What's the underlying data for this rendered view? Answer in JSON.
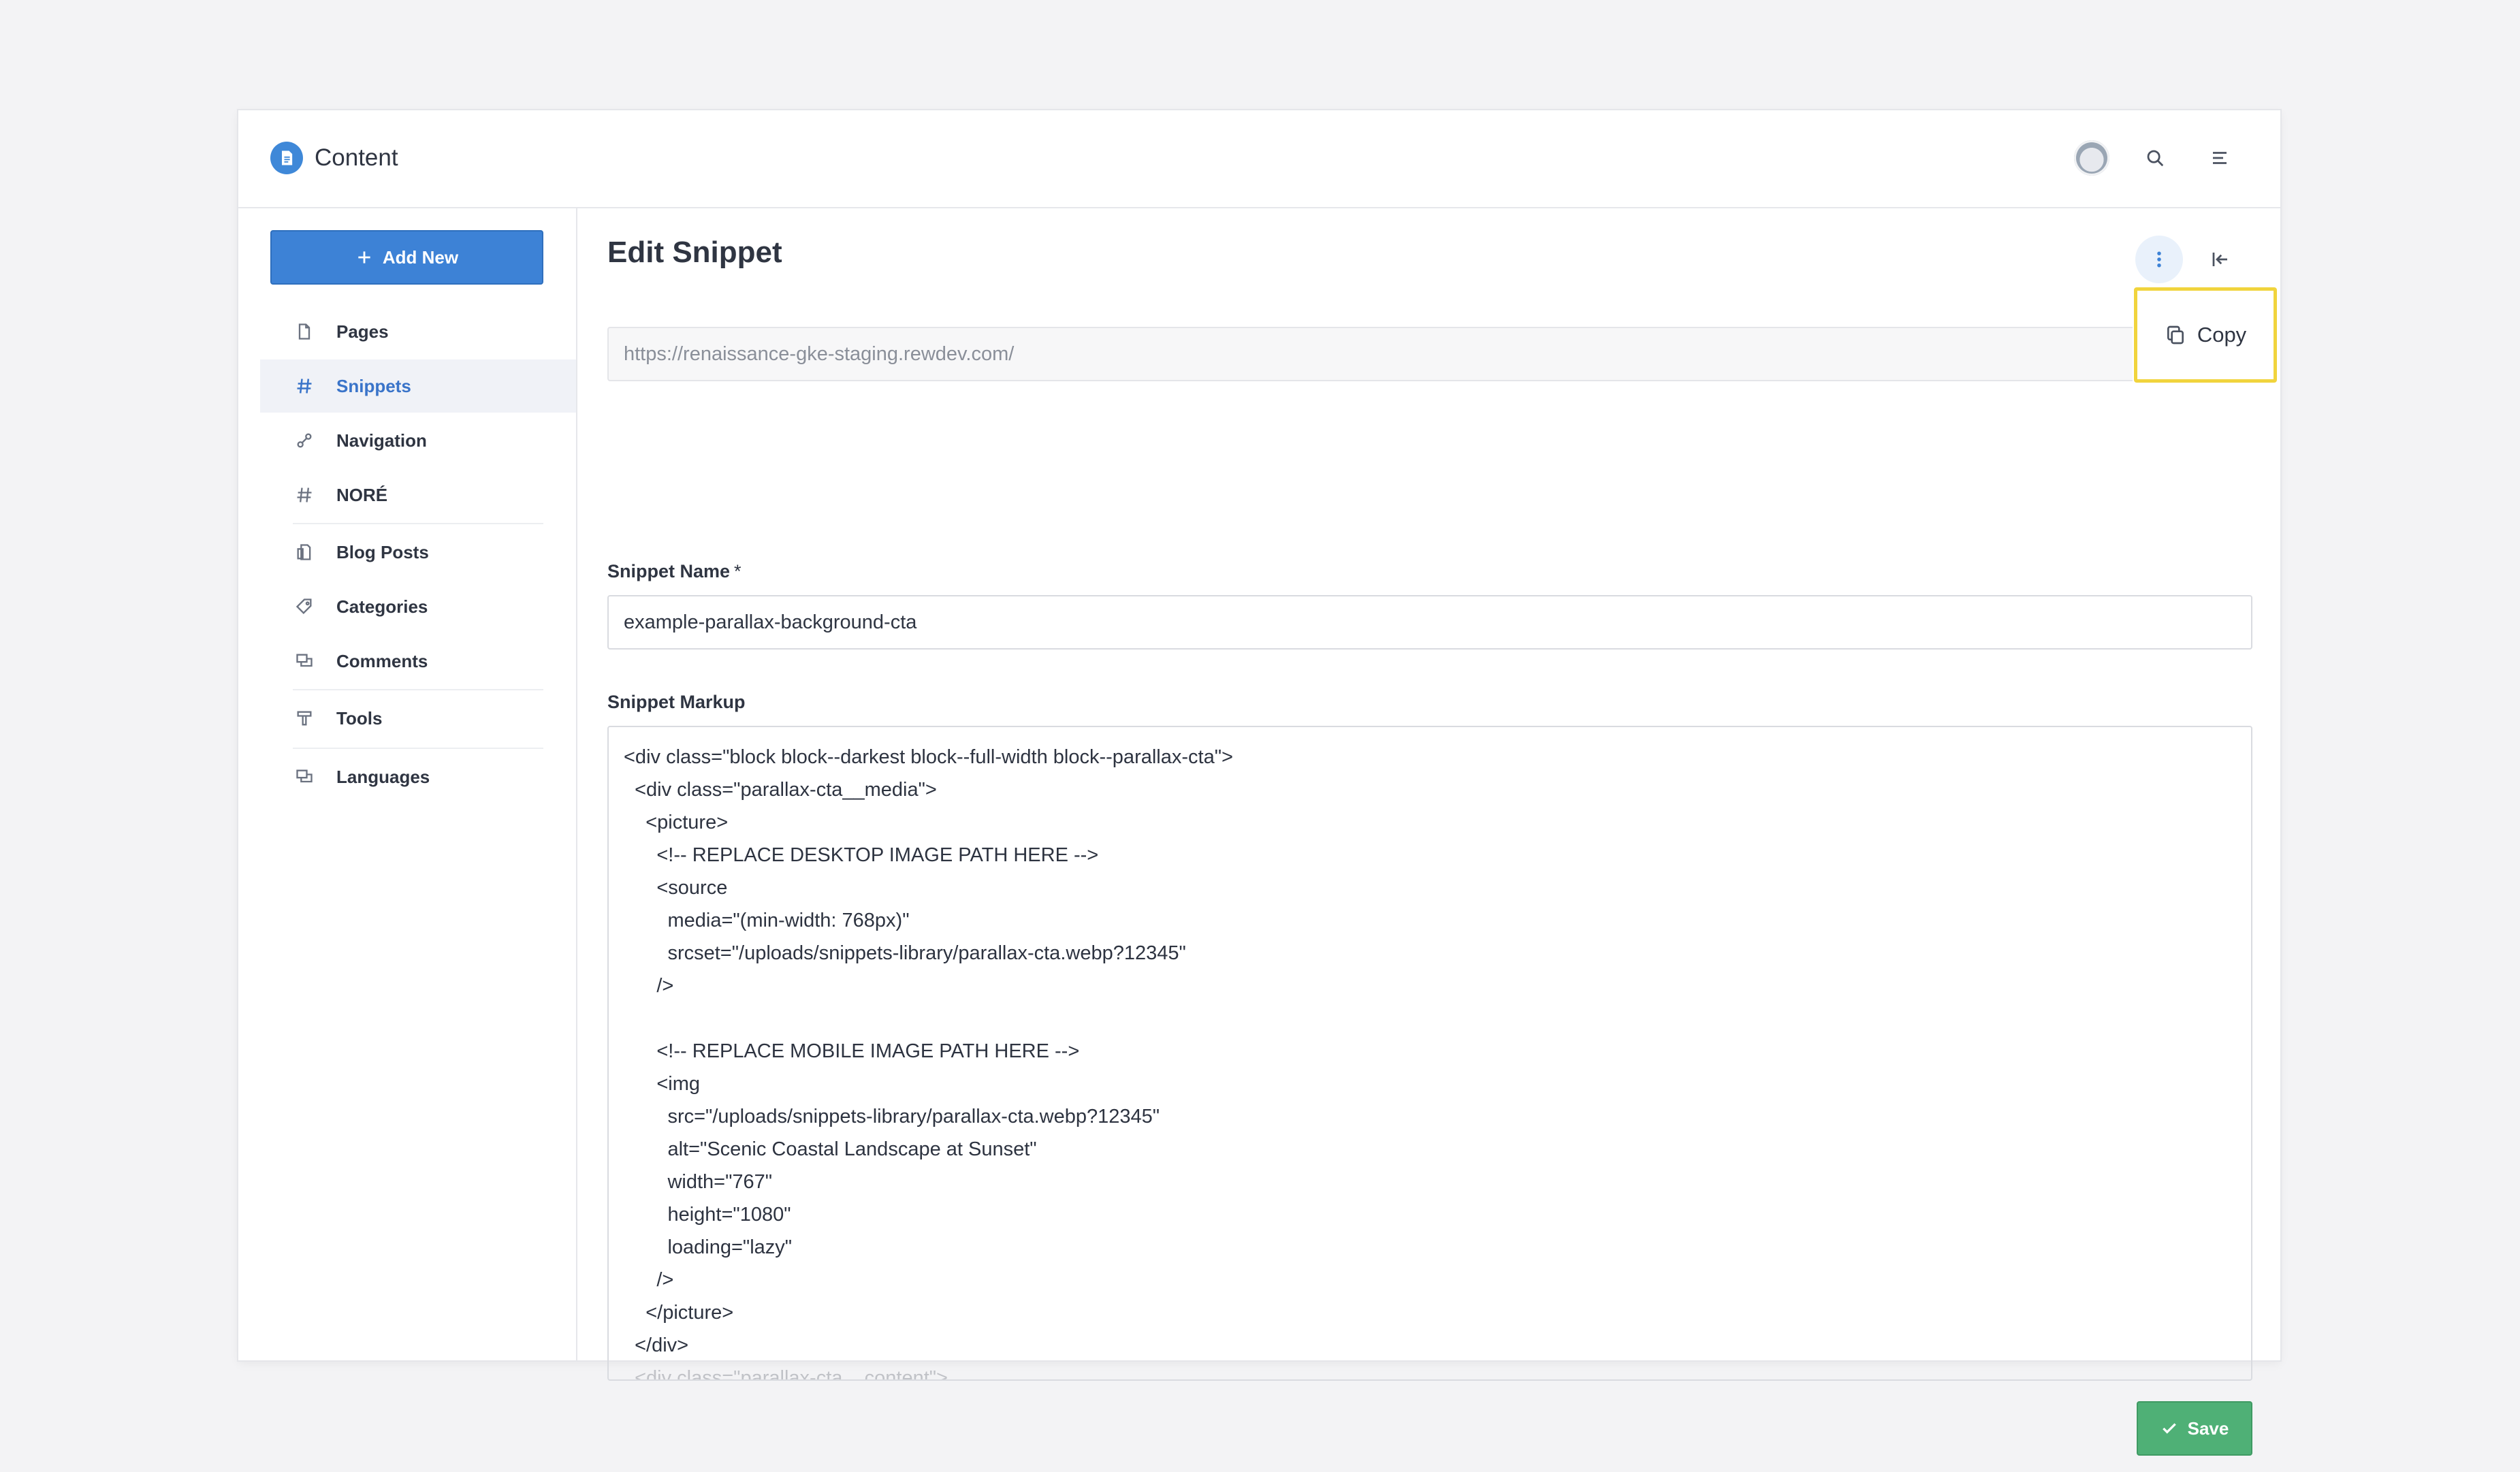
{
  "app": {
    "title": "Content"
  },
  "sidebar": {
    "add_new_label": "Add New",
    "items": [
      {
        "label": "Pages",
        "icon": "page-icon",
        "active": false
      },
      {
        "label": "Snippets",
        "icon": "hash-icon",
        "active": true
      },
      {
        "label": "Navigation",
        "icon": "link-icon",
        "active": false
      },
      {
        "label": "NORÉ",
        "icon": "hash-icon",
        "active": false
      },
      {
        "label": "Blog Posts",
        "icon": "blog-icon",
        "active": false
      },
      {
        "label": "Categories",
        "icon": "tag-icon",
        "active": false
      },
      {
        "label": "Comments",
        "icon": "comments-icon",
        "active": false
      },
      {
        "label": "Tools",
        "icon": "tools-icon",
        "active": false
      },
      {
        "label": "Languages",
        "icon": "languages-icon",
        "active": false
      }
    ]
  },
  "main": {
    "title": "Edit Snippet",
    "url": "https://renaissance-gke-staging.rewdev.com/",
    "copy_label": "Copy",
    "snippet_name_label": "Snippet Name",
    "required_mark": "*",
    "snippet_name_value": "example-parallax-background-cta",
    "snippet_markup_label": "Snippet Markup",
    "markup_lines": [
      "<div class=\"block block--darkest block--full-width block--parallax-cta\">",
      "  <div class=\"parallax-cta__media\">",
      "    <picture>",
      "      <!-- REPLACE DESKTOP IMAGE PATH HERE -->",
      "      <source",
      "        media=\"(min-width: 768px)\"",
      "        srcset=\"/uploads/snippets-library/parallax-cta.webp?12345\"",
      "      />",
      "",
      "      <!-- REPLACE MOBILE IMAGE PATH HERE -->",
      "      <img",
      "        src=\"/uploads/snippets-library/parallax-cta.webp?12345\"",
      "        alt=\"Scenic Coastal Landscape at Sunset\"",
      "        width=\"767\"",
      "        height=\"1080\"",
      "        loading=\"lazy\"",
      "      />",
      "    </picture>",
      "  </div>",
      "  <div class=\"parallax-cta__content\">"
    ],
    "save_label": "Save"
  },
  "colors": {
    "primary": "#3d82d6",
    "success": "#4fb076",
    "highlight": "#f1d43d",
    "active_nav_text": "#3a74c9"
  }
}
